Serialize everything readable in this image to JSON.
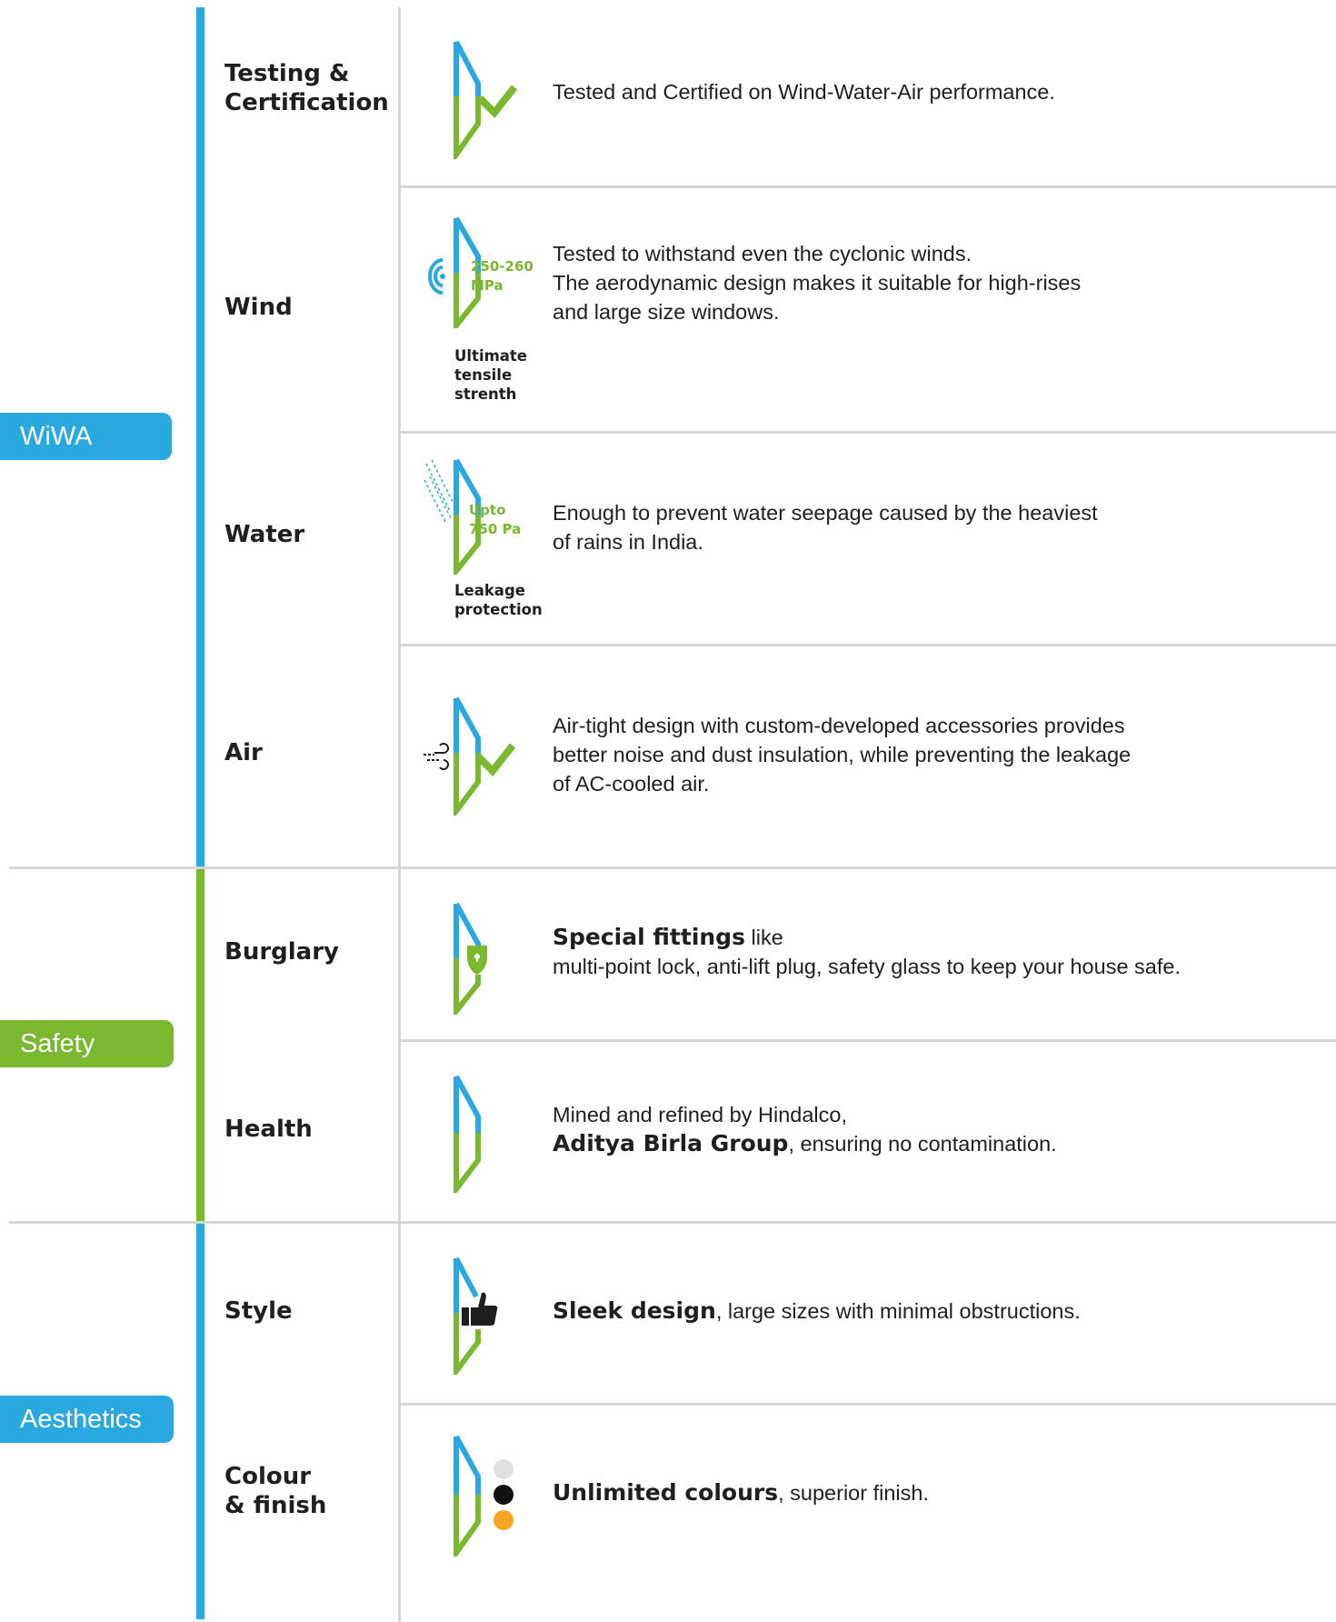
{
  "colors": {
    "blue": "#2aa9e0",
    "green": "#7ab830",
    "separator": "#d6d6d6"
  },
  "categories": [
    {
      "label": "WiWA",
      "color": "#2aa9e0"
    },
    {
      "label": "Safety",
      "color": "#7ab830"
    },
    {
      "label": "Aesthetics",
      "color": "#2aa9e0"
    }
  ],
  "rows": [
    {
      "label_lines": [
        "Testing &",
        "Certification"
      ],
      "icon": "window-check-icon",
      "desc_lines": [
        "Tested and Certified on Wind-Water-Air performance."
      ]
    },
    {
      "label_lines": [
        "Wind"
      ],
      "icon": "window-wind-icon",
      "spec": [
        "250-260",
        "MPa"
      ],
      "caption": [
        "Ultimate",
        "tensile",
        "strenth"
      ],
      "desc_lines": [
        "Tested to withstand even the cyclonic winds.",
        "The aerodynamic design makes it suitable for high-rises",
        "and large size windows."
      ]
    },
    {
      "label_lines": [
        "Water"
      ],
      "icon": "window-rain-icon",
      "spec": [
        "Upto",
        "750 Pa"
      ],
      "caption": [
        "Leakage",
        "protection"
      ],
      "desc_lines": [
        "Enough to prevent water seepage caused by the heaviest",
        "of rains in India."
      ]
    },
    {
      "label_lines": [
        "Air"
      ],
      "icon": "window-air-check-icon",
      "desc_lines": [
        "Air-tight design with custom-developed accessories provides",
        "better noise and dust insulation, while preventing the leakage",
        "of AC-cooled air."
      ]
    },
    {
      "label_lines": [
        "Burglary"
      ],
      "icon": "window-shield-icon",
      "desc_bold": "Special fittings",
      "desc_after": " like",
      "desc_line2": "multi-point lock, anti-lift plug, safety glass to keep your house safe."
    },
    {
      "label_lines": [
        "Health"
      ],
      "icon": "window-icon",
      "desc_line1": "Mined and refined by Hindalco,",
      "desc_bold": "Aditya Birla Group",
      "desc_after": ", ensuring no contamination."
    },
    {
      "label_lines": [
        "Style"
      ],
      "icon": "window-thumbs-up-icon",
      "desc_bold": "Sleek design",
      "desc_after": ", large sizes with minimal obstructions."
    },
    {
      "label_lines": [
        "Colour",
        "& finish"
      ],
      "icon": "window-colour-dots-icon",
      "swatches": [
        "#e0e0e0",
        "#111111",
        "#f5a623"
      ],
      "desc_bold": "Unlimited colours",
      "desc_after": ", superior finish."
    }
  ]
}
